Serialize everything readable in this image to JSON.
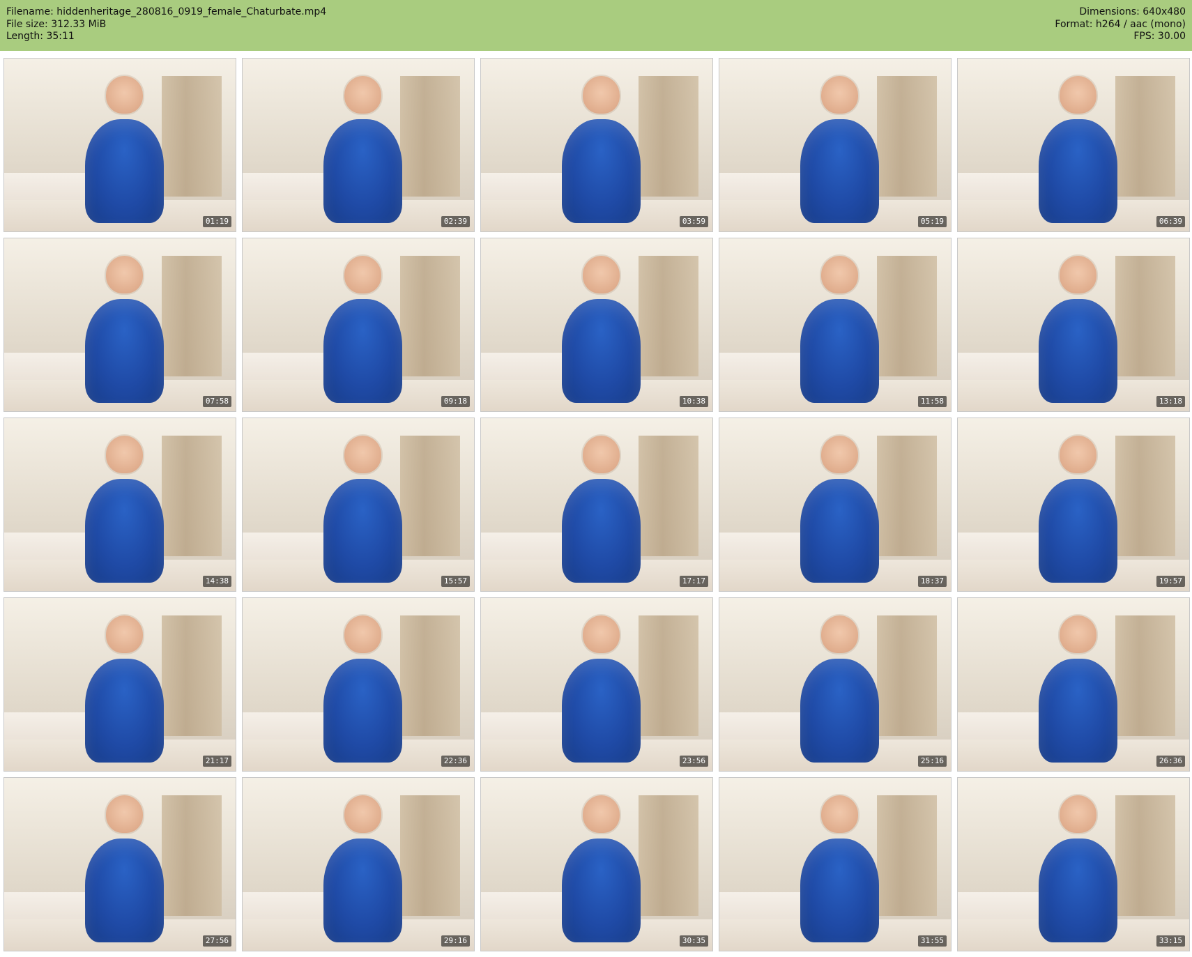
{
  "header": {
    "filename_label": "Filename: hiddenheritage_280816_0919_female_Chaturbate.mp4",
    "file_size_label": "File size: 312.33 MiB",
    "length_label": "Length: 35:11",
    "dimensions_label": "Dimensions: 640x480",
    "format_label": "Format: h264 / aac (mono)",
    "fps_label": "FPS: 30.00",
    "background_color": "#a9cc7f"
  },
  "thumbnails": [
    {
      "time": "01:19"
    },
    {
      "time": "02:39"
    },
    {
      "time": "03:59"
    },
    {
      "time": "05:19"
    },
    {
      "time": "06:39"
    },
    {
      "time": "07:58"
    },
    {
      "time": "09:18"
    },
    {
      "time": "10:38"
    },
    {
      "time": "11:58"
    },
    {
      "time": "13:18"
    },
    {
      "time": "14:38"
    },
    {
      "time": "15:57"
    },
    {
      "time": "17:17"
    },
    {
      "time": "18:37"
    },
    {
      "time": "19:57"
    },
    {
      "time": "21:17"
    },
    {
      "time": "22:36"
    },
    {
      "time": "23:56"
    },
    {
      "time": "25:16"
    },
    {
      "time": "26:36"
    },
    {
      "time": "27:56"
    },
    {
      "time": "29:16"
    },
    {
      "time": "30:35"
    },
    {
      "time": "31:55"
    },
    {
      "time": "33:15"
    }
  ]
}
